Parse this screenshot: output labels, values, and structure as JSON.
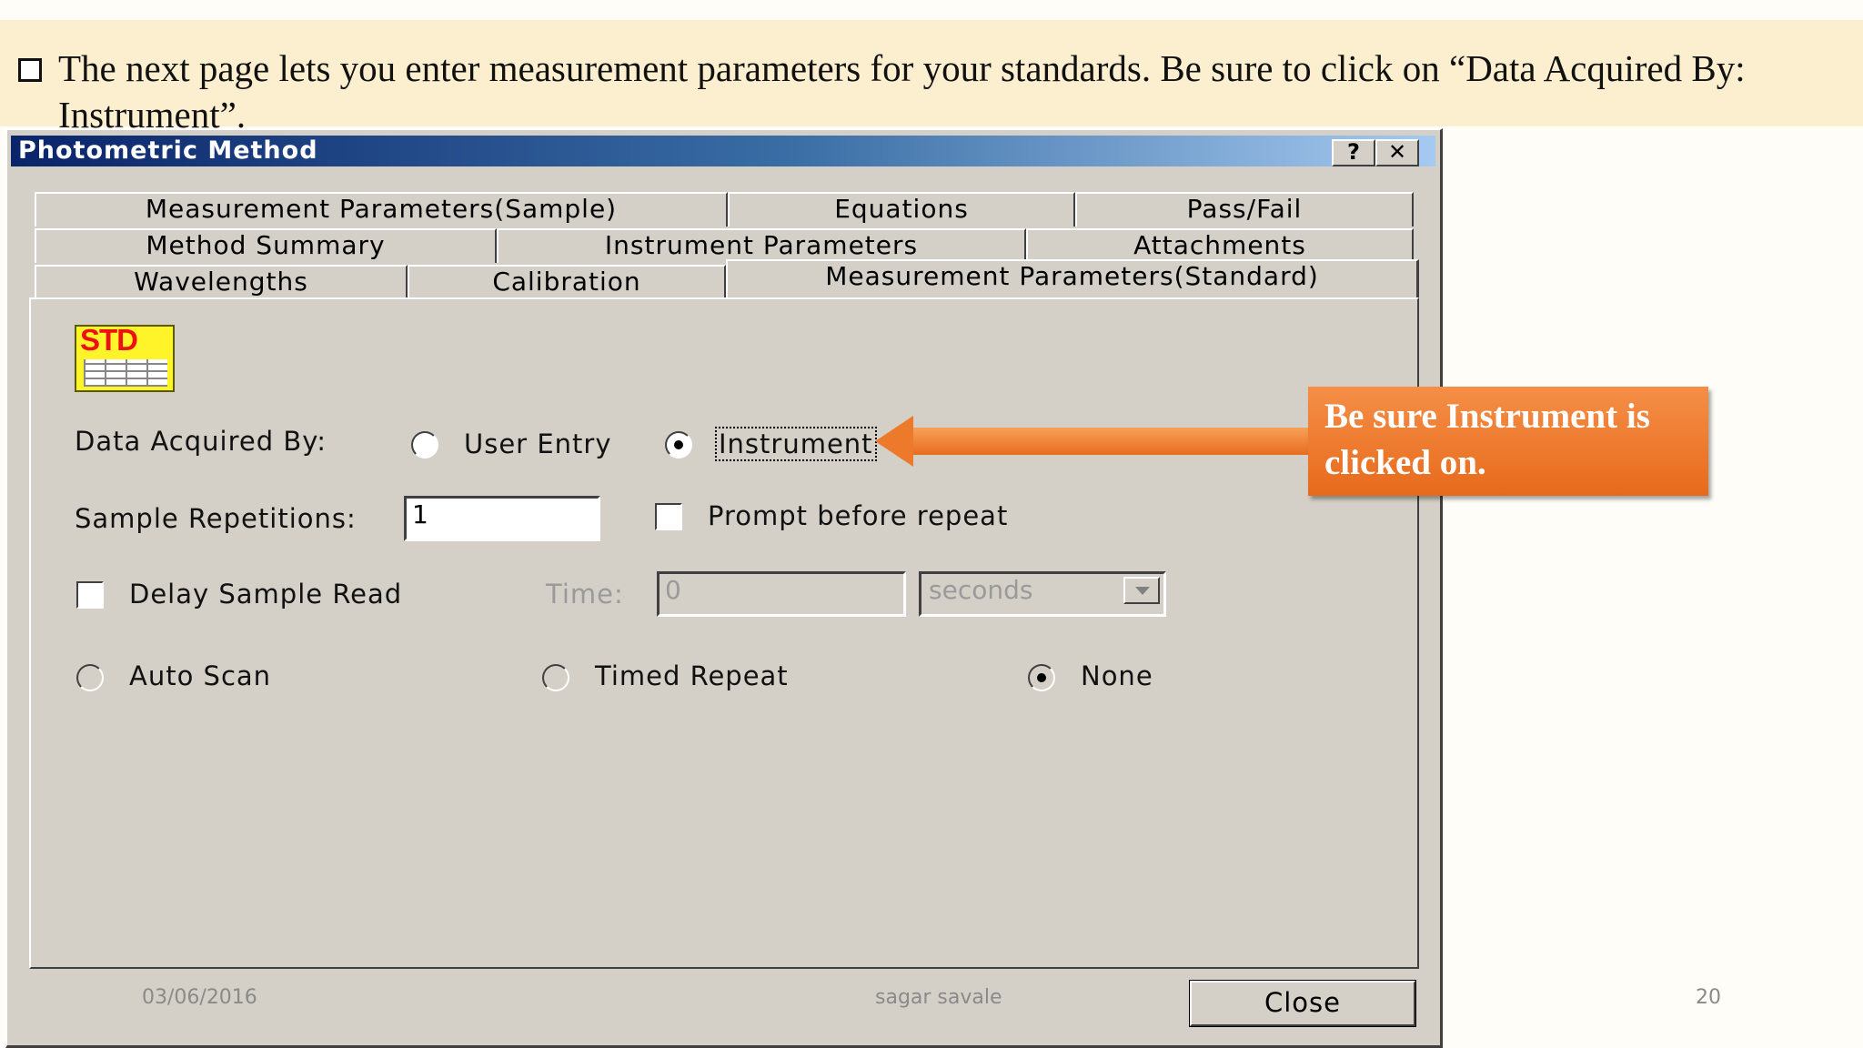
{
  "header": {
    "text": "The next page lets you enter measurement parameters for your standards. Be sure to click on “Data Acquired By: Instrument”."
  },
  "window": {
    "title": "Photometric Method",
    "help_label": "?",
    "close_label": "✕"
  },
  "tabs": {
    "row1": [
      "Measurement Parameters(Sample)",
      "Equations",
      "Pass/Fail"
    ],
    "row2": [
      "Method Summary",
      "Instrument Parameters",
      "Attachments"
    ],
    "row3": [
      "Wavelengths",
      "Calibration",
      "Measurement Parameters(Standard)"
    ]
  },
  "panel": {
    "icon_label": "STD",
    "data_acquired_label": "Data Acquired By:",
    "user_entry_label": "User Entry",
    "instrument_label": "Instrument",
    "selected_source": "Instrument",
    "sample_repetitions_label": "Sample Repetitions:",
    "sample_repetitions_value": "1",
    "prompt_repeat_label": "Prompt before repeat",
    "delay_read_label": "Delay Sample Read",
    "time_label": "Time:",
    "time_value": "0",
    "time_unit": "seconds",
    "auto_scan_label": "Auto Scan",
    "timed_repeat_label": "Timed Repeat",
    "none_label": "None",
    "selected_mode": "None"
  },
  "buttons": {
    "close": "Close"
  },
  "callout": {
    "text": "Be sure Instrument is clicked on."
  },
  "footer": {
    "date": "03/06/2016",
    "author": "sagar savale",
    "page": "20"
  },
  "colors": {
    "callout": "#ed7d31",
    "header_band": "#fcefcf",
    "titlebar": "#0a246a",
    "dialog": "#d4d0c8"
  }
}
